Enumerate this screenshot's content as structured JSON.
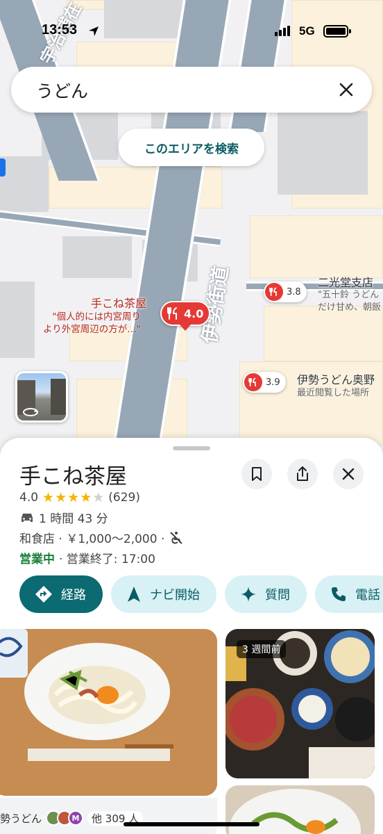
{
  "status_bar": {
    "time": "13:53",
    "network": "5G"
  },
  "search": {
    "query": "うどん"
  },
  "map": {
    "search_area_button": "このエリアを検索",
    "road_main": "伊勢街道",
    "road_left": "宇治浦在",
    "selected_place": {
      "name": "手こね茶屋",
      "snippet_line1": "\"個人的には内宮周り",
      "snippet_line2": "より外宮周辺の方が…\"",
      "rating": "4.0"
    },
    "places": [
      {
        "name": "二光堂支店",
        "rating": "3.8",
        "snippet_line1": "\"五十鈴 うどん",
        "snippet_line2": "だけ甘め、朝飯"
      },
      {
        "name": "伊勢うどん奥野",
        "rating": "3.9",
        "snippet_line1": "最近閲覧した場所"
      }
    ]
  },
  "sheet": {
    "title": "手こね茶屋",
    "rating": "4.0",
    "stars_filled": 4,
    "review_count": "(629)",
    "drive_time": "1 時間 43 分",
    "category_price": "和食店 · ￥1,000～2,000 ·",
    "open_status": "営業中",
    "hours": "· 営業終了: 17:00",
    "actions": {
      "directions": "経路",
      "start": "ナビ開始",
      "ask": "質問",
      "call": "電話"
    },
    "photo_time_tag": "3 週間前",
    "photo_caption_prefix": "勢うどん",
    "photo_caption_avatar": "M",
    "photo_caption_count": "他 309 人"
  },
  "colors": {
    "accent_teal": "#0b6a72",
    "chip_bg": "#d7f1f5",
    "pin_red": "#e53935",
    "open_green": "#188038",
    "star": "#f4b400"
  }
}
